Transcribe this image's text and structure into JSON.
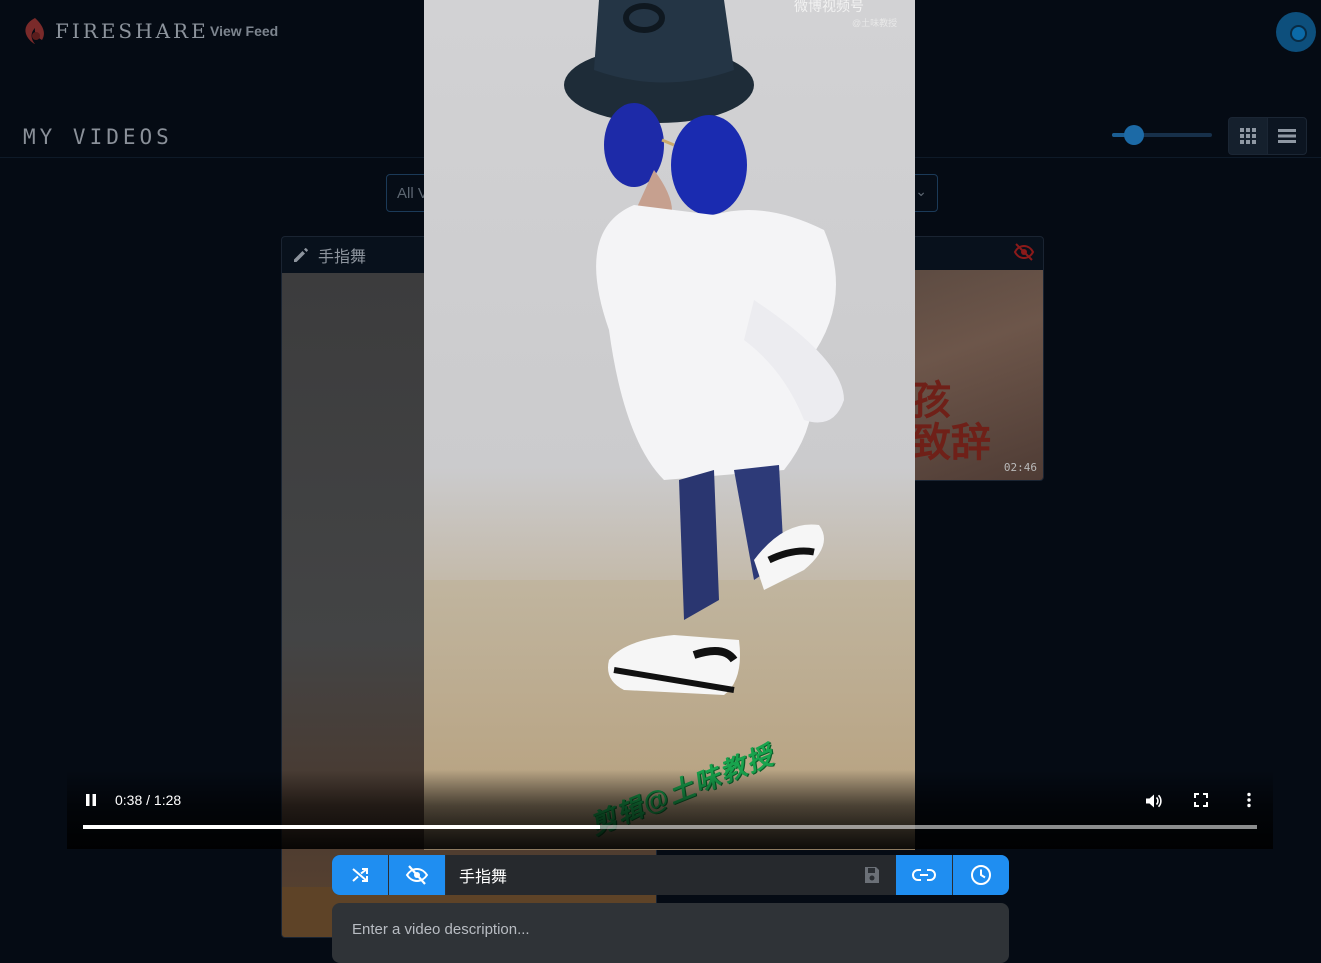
{
  "app": {
    "brand": "FIRESHARE",
    "nav_view_feed": "View Feed",
    "page_title": "MY VIDEOS"
  },
  "filter": {
    "selected": "All V"
  },
  "cards": [
    {
      "title": "手指舞"
    },
    {
      "duration": "02:46",
      "thumb_text": "孩\n致辞"
    }
  ],
  "player": {
    "time": "0:38 / 1:28",
    "progress": 0.44,
    "watermark_top": "微博视频号",
    "watermark_sub": "@土味教授",
    "subtitle": "剪辑@土味教授"
  },
  "action_bar": {
    "title_value": "手指舞",
    "description_placeholder": "Enter a video description..."
  },
  "colors": {
    "accent": "#1f8ef1",
    "background": "#050b14",
    "hidden_icon": "#8b1a1a"
  },
  "icons": [
    "logo-icon",
    "avatar-icon",
    "grid-view-icon",
    "list-view-icon",
    "edit-icon",
    "eye-off-icon",
    "pause-icon",
    "volume-icon",
    "fullscreen-icon",
    "more-vert-icon",
    "shuffle-icon",
    "save-icon",
    "link-icon",
    "clock-icon"
  ]
}
